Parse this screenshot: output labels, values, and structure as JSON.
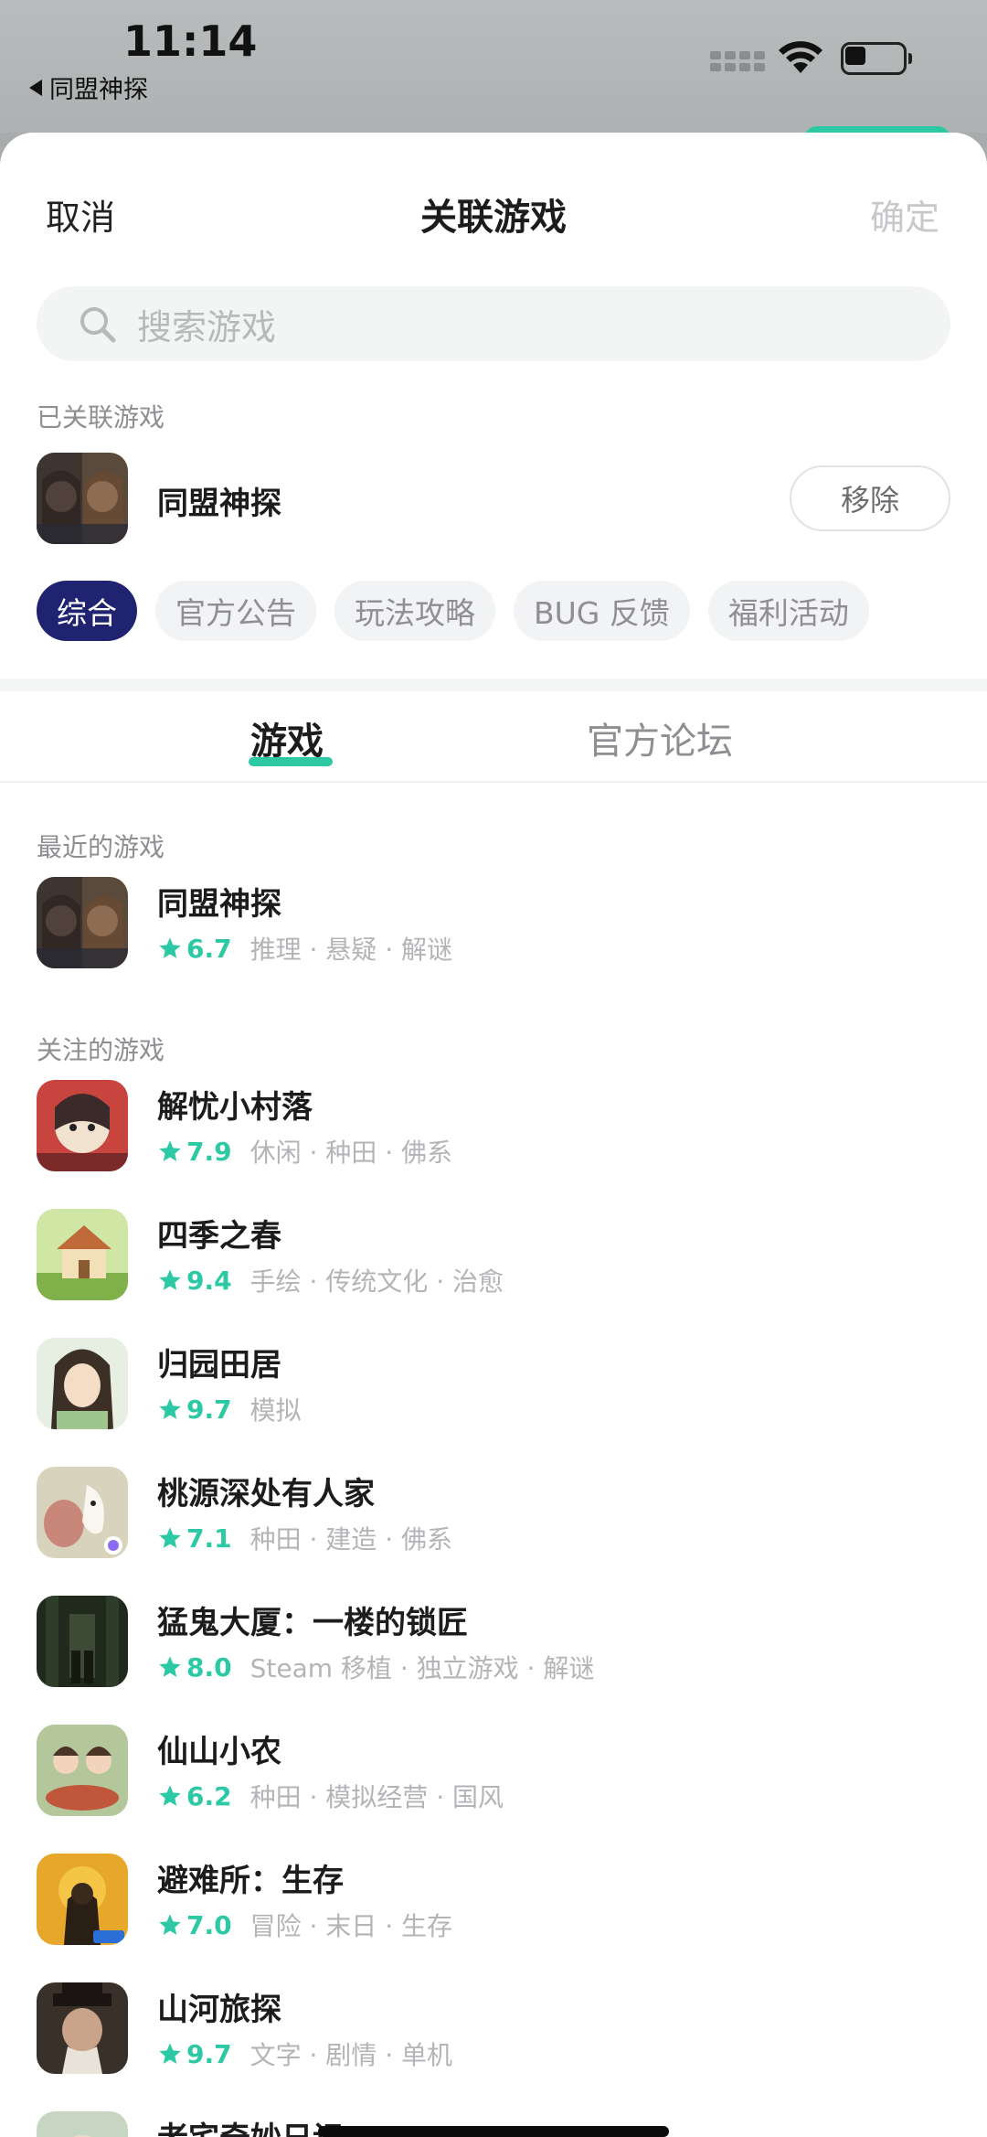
{
  "status_bar": {
    "time": "11:14",
    "back_app": "同盟神探"
  },
  "header": {
    "cancel_label": "取消",
    "title": "关联游戏",
    "confirm_label": "确定"
  },
  "search": {
    "placeholder": "搜索游戏"
  },
  "linked": {
    "section_label": "已关联游戏",
    "name": "同盟神探",
    "remove_label": "移除"
  },
  "chips": [
    "综合",
    "官方公告",
    "玩法攻略",
    "BUG 反馈",
    "福利活动"
  ],
  "tabs": {
    "games": "游戏",
    "forum": "官方论坛"
  },
  "recent": {
    "section_label": "最近的游戏",
    "games": [
      {
        "name": "同盟神探",
        "score": "6.7",
        "tags": "推理 · 悬疑 · 解谜"
      }
    ]
  },
  "followed": {
    "section_label": "关注的游戏",
    "games": [
      {
        "name": "解忧小村落",
        "score": "7.9",
        "tags": "休闲 · 种田 · 佛系"
      },
      {
        "name": "四季之春",
        "score": "9.4",
        "tags": "手绘 · 传统文化 · 治愈"
      },
      {
        "name": "归园田居",
        "score": "9.7",
        "tags": "模拟"
      },
      {
        "name": "桃源深处有人家",
        "score": "7.1",
        "tags": "种田 · 建造 · 佛系"
      },
      {
        "name": "猛鬼大厦：一楼的锁匠",
        "score": "8.0",
        "tags": "Steam 移植 · 独立游戏 · 解谜"
      },
      {
        "name": "仙山小农",
        "score": "6.2",
        "tags": "种田 · 模拟经营 · 国风"
      },
      {
        "name": "避难所：生存",
        "score": "7.0",
        "tags": "冒险 · 末日 · 生存"
      },
      {
        "name": "山河旅探",
        "score": "9.7",
        "tags": "文字 · 剧情 · 单机"
      },
      {
        "name": "老宅奇妙日记",
        "score": "",
        "tags": ""
      }
    ]
  },
  "colors": {
    "accent_green": "#2cc9a4",
    "chip_active": "#1f2370"
  }
}
